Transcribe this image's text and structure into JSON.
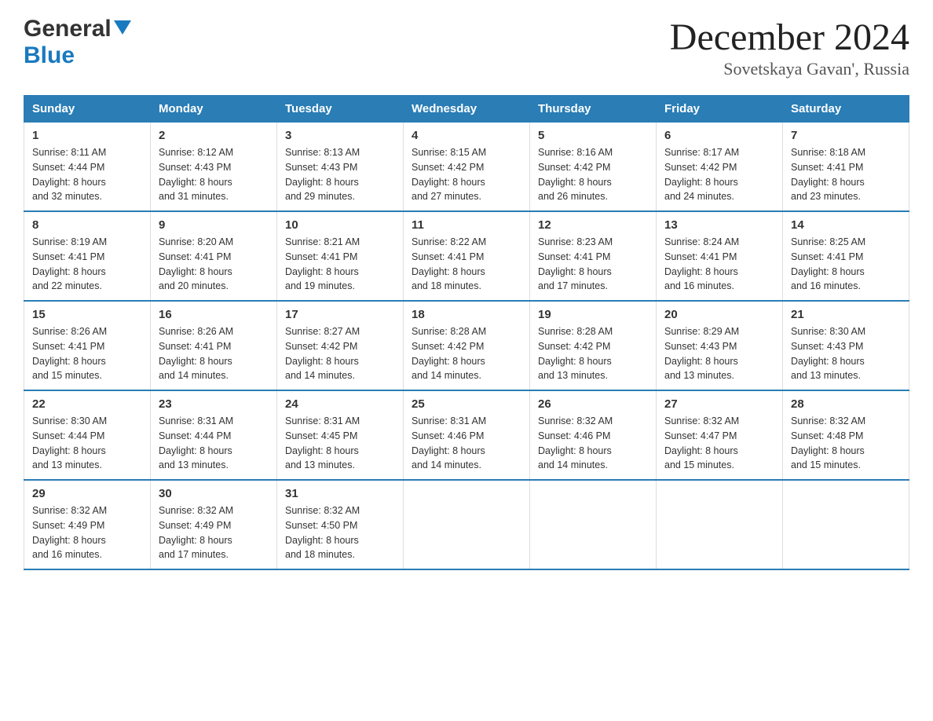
{
  "header": {
    "logo_general": "General",
    "logo_blue": "Blue",
    "month_year": "December 2024",
    "location": "Sovetskaya Gavan', Russia"
  },
  "days_of_week": [
    "Sunday",
    "Monday",
    "Tuesday",
    "Wednesday",
    "Thursday",
    "Friday",
    "Saturday"
  ],
  "weeks": [
    [
      {
        "day": "1",
        "sunrise": "8:11 AM",
        "sunset": "4:44 PM",
        "daylight": "8 hours and 32 minutes."
      },
      {
        "day": "2",
        "sunrise": "8:12 AM",
        "sunset": "4:43 PM",
        "daylight": "8 hours and 31 minutes."
      },
      {
        "day": "3",
        "sunrise": "8:13 AM",
        "sunset": "4:43 PM",
        "daylight": "8 hours and 29 minutes."
      },
      {
        "day": "4",
        "sunrise": "8:15 AM",
        "sunset": "4:42 PM",
        "daylight": "8 hours and 27 minutes."
      },
      {
        "day": "5",
        "sunrise": "8:16 AM",
        "sunset": "4:42 PM",
        "daylight": "8 hours and 26 minutes."
      },
      {
        "day": "6",
        "sunrise": "8:17 AM",
        "sunset": "4:42 PM",
        "daylight": "8 hours and 24 minutes."
      },
      {
        "day": "7",
        "sunrise": "8:18 AM",
        "sunset": "4:41 PM",
        "daylight": "8 hours and 23 minutes."
      }
    ],
    [
      {
        "day": "8",
        "sunrise": "8:19 AM",
        "sunset": "4:41 PM",
        "daylight": "8 hours and 22 minutes."
      },
      {
        "day": "9",
        "sunrise": "8:20 AM",
        "sunset": "4:41 PM",
        "daylight": "8 hours and 20 minutes."
      },
      {
        "day": "10",
        "sunrise": "8:21 AM",
        "sunset": "4:41 PM",
        "daylight": "8 hours and 19 minutes."
      },
      {
        "day": "11",
        "sunrise": "8:22 AM",
        "sunset": "4:41 PM",
        "daylight": "8 hours and 18 minutes."
      },
      {
        "day": "12",
        "sunrise": "8:23 AM",
        "sunset": "4:41 PM",
        "daylight": "8 hours and 17 minutes."
      },
      {
        "day": "13",
        "sunrise": "8:24 AM",
        "sunset": "4:41 PM",
        "daylight": "8 hours and 16 minutes."
      },
      {
        "day": "14",
        "sunrise": "8:25 AM",
        "sunset": "4:41 PM",
        "daylight": "8 hours and 16 minutes."
      }
    ],
    [
      {
        "day": "15",
        "sunrise": "8:26 AM",
        "sunset": "4:41 PM",
        "daylight": "8 hours and 15 minutes."
      },
      {
        "day": "16",
        "sunrise": "8:26 AM",
        "sunset": "4:41 PM",
        "daylight": "8 hours and 14 minutes."
      },
      {
        "day": "17",
        "sunrise": "8:27 AM",
        "sunset": "4:42 PM",
        "daylight": "8 hours and 14 minutes."
      },
      {
        "day": "18",
        "sunrise": "8:28 AM",
        "sunset": "4:42 PM",
        "daylight": "8 hours and 14 minutes."
      },
      {
        "day": "19",
        "sunrise": "8:28 AM",
        "sunset": "4:42 PM",
        "daylight": "8 hours and 13 minutes."
      },
      {
        "day": "20",
        "sunrise": "8:29 AM",
        "sunset": "4:43 PM",
        "daylight": "8 hours and 13 minutes."
      },
      {
        "day": "21",
        "sunrise": "8:30 AM",
        "sunset": "4:43 PM",
        "daylight": "8 hours and 13 minutes."
      }
    ],
    [
      {
        "day": "22",
        "sunrise": "8:30 AM",
        "sunset": "4:44 PM",
        "daylight": "8 hours and 13 minutes."
      },
      {
        "day": "23",
        "sunrise": "8:31 AM",
        "sunset": "4:44 PM",
        "daylight": "8 hours and 13 minutes."
      },
      {
        "day": "24",
        "sunrise": "8:31 AM",
        "sunset": "4:45 PM",
        "daylight": "8 hours and 13 minutes."
      },
      {
        "day": "25",
        "sunrise": "8:31 AM",
        "sunset": "4:46 PM",
        "daylight": "8 hours and 14 minutes."
      },
      {
        "day": "26",
        "sunrise": "8:32 AM",
        "sunset": "4:46 PM",
        "daylight": "8 hours and 14 minutes."
      },
      {
        "day": "27",
        "sunrise": "8:32 AM",
        "sunset": "4:47 PM",
        "daylight": "8 hours and 15 minutes."
      },
      {
        "day": "28",
        "sunrise": "8:32 AM",
        "sunset": "4:48 PM",
        "daylight": "8 hours and 15 minutes."
      }
    ],
    [
      {
        "day": "29",
        "sunrise": "8:32 AM",
        "sunset": "4:49 PM",
        "daylight": "8 hours and 16 minutes."
      },
      {
        "day": "30",
        "sunrise": "8:32 AM",
        "sunset": "4:49 PM",
        "daylight": "8 hours and 17 minutes."
      },
      {
        "day": "31",
        "sunrise": "8:32 AM",
        "sunset": "4:50 PM",
        "daylight": "8 hours and 18 minutes."
      },
      null,
      null,
      null,
      null
    ]
  ],
  "labels": {
    "sunrise": "Sunrise:",
    "sunset": "Sunset:",
    "daylight": "Daylight:"
  },
  "colors": {
    "header_bg": "#2a7db5",
    "border": "#2a7db5",
    "logo_blue": "#1a7abf"
  }
}
